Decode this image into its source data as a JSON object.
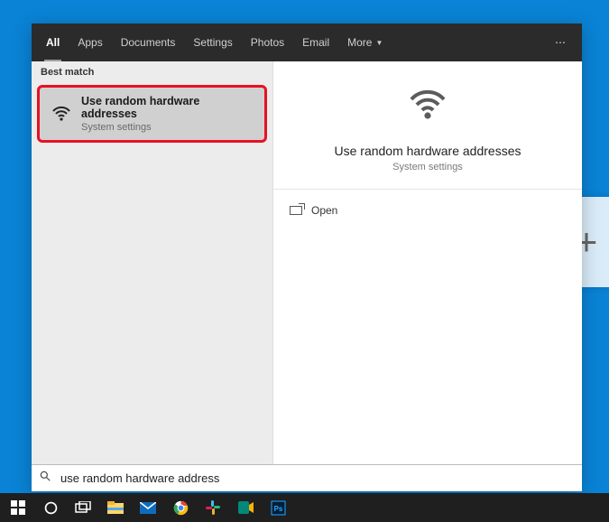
{
  "topTabs": {
    "all": "All",
    "apps": "Apps",
    "documents": "Documents",
    "settings": "Settings",
    "photos": "Photos",
    "email": "Email",
    "more": "More"
  },
  "sections": {
    "bestMatch": "Best match"
  },
  "result": {
    "title": "Use random hardware addresses",
    "subtitle": "System settings"
  },
  "preview": {
    "title": "Use random hardware addresses",
    "subtitle": "System settings",
    "openLabel": "Open"
  },
  "search": {
    "value": "use random hardware address"
  },
  "taskWidget": {
    "plus": "+"
  }
}
